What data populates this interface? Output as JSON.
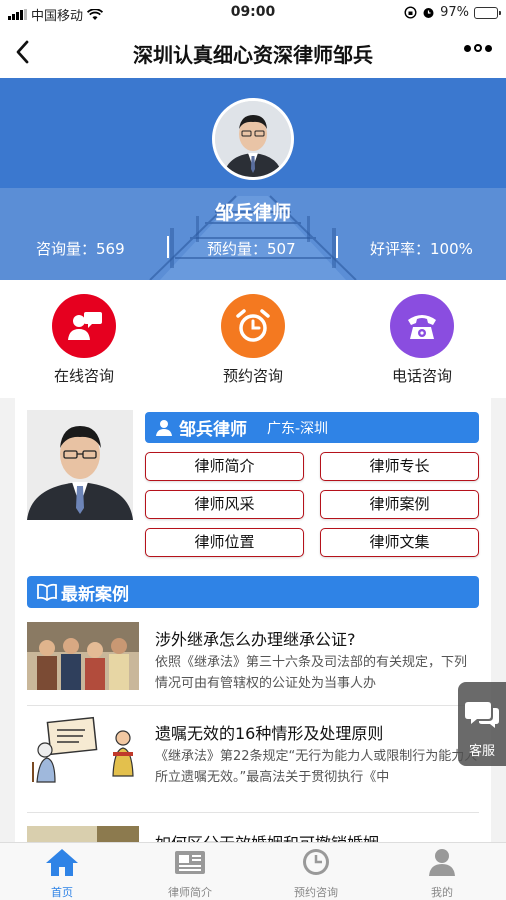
{
  "status_bar": {
    "carrier": "中国移动",
    "time": "09:00",
    "battery": "97%",
    "battery_level": 0.97
  },
  "nav": {
    "title": "深圳认真细心资深律师邹兵"
  },
  "banner": {
    "name": "邹兵律师",
    "stats": [
      {
        "label": "咨询量：",
        "value": "569"
      },
      {
        "label": "预约量：",
        "value": "507"
      },
      {
        "label": "好评率：",
        "value": "100%"
      }
    ]
  },
  "actions": [
    {
      "label": "在线咨询",
      "icon": "chat-person-icon",
      "color": "#e6001f"
    },
    {
      "label": "预约咨询",
      "icon": "alarm-clock-icon",
      "color": "#f47920"
    },
    {
      "label": "电话咨询",
      "icon": "telephone-icon",
      "color": "#8a4de0"
    }
  ],
  "profile": {
    "name": "邹兵律师",
    "location": "广东-深圳",
    "buttons": [
      "律师简介",
      "律师专长",
      "律师风采",
      "律师案例",
      "律师位置",
      "律师文集"
    ]
  },
  "cases": {
    "section_title": "最新案例",
    "items": [
      {
        "title": "涉外继承怎么办理继承公证?",
        "desc": "依照《继承法》第三十六条及司法部的有关规定，下列情况可由有管辖权的公证处为当事人办"
      },
      {
        "title": "遗嘱无效的16种情形及处理原则",
        "desc": "《继承法》第22条规定“无行为能力人或限制行为能力人所立遗嘱无效。”最高法关于贯彻执行《中"
      },
      {
        "title": "如何区分无效婚姻和可撤销婚姻",
        "desc": ""
      }
    ]
  },
  "float_service": {
    "label": "客服"
  },
  "tabbar": {
    "items": [
      {
        "label": "首页",
        "icon": "home-icon",
        "active": true
      },
      {
        "label": "律师简介",
        "icon": "newspaper-icon",
        "active": false
      },
      {
        "label": "预约咨询",
        "icon": "clock-icon",
        "active": false
      },
      {
        "label": "我的",
        "icon": "user-icon",
        "active": false
      }
    ],
    "active_color": "#2f83e6",
    "inactive_color": "#999999"
  }
}
